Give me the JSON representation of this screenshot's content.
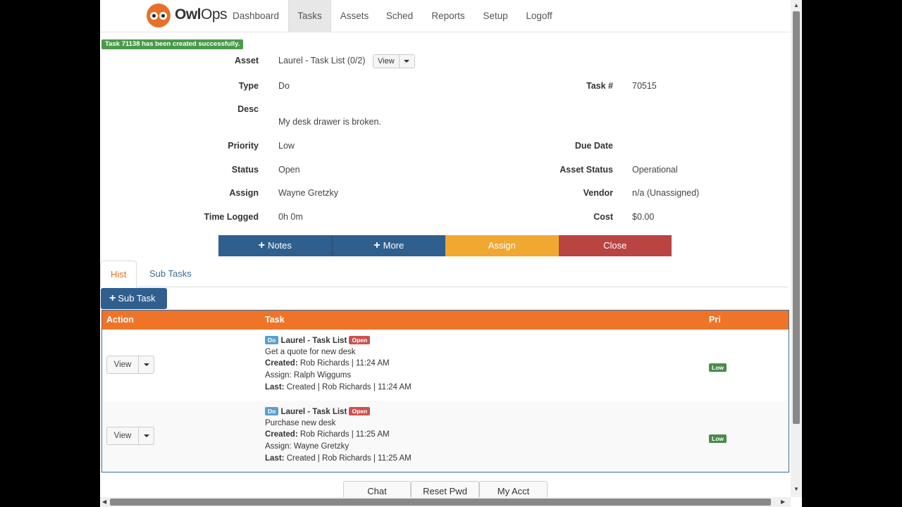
{
  "nav": {
    "brand_bold": "Owl",
    "brand_rest": "Ops",
    "items": [
      {
        "label": "Dashboard"
      },
      {
        "label": "Tasks"
      },
      {
        "label": "Assets"
      },
      {
        "label": "Sched"
      },
      {
        "label": "Reports"
      },
      {
        "label": "Setup"
      },
      {
        "label": "Logoff"
      }
    ]
  },
  "flash": "Task 71138 has been created successfully.",
  "details": {
    "asset_label": "Asset",
    "asset_value": "Laurel - Task List (0/2)",
    "view_label": "View",
    "type_label": "Type",
    "type_value": "Do",
    "task_no_label": "Task #",
    "task_no_value": "70515",
    "desc_label": "Desc",
    "desc_value": "My desk drawer is broken.",
    "priority_label": "Priority",
    "priority_value": "Low",
    "due_label": "Due Date",
    "due_value": "",
    "status_label": "Status",
    "status_value": "Open",
    "asset_status_label": "Asset Status",
    "asset_status_value": "Operational",
    "assign_label": "Assign",
    "assign_value": "Wayne Gretzky",
    "vendor_label": "Vendor",
    "vendor_value": "n/a (Unassigned)",
    "time_label": "Time Logged",
    "time_value": "0h 0m",
    "cost_label": "Cost",
    "cost_value": "$0.00"
  },
  "actions": {
    "notes": "Notes",
    "more": "More",
    "assign": "Assign",
    "close": "Close",
    "colors": {
      "notes": "#2f5f8f",
      "more": "#2f5f8f",
      "assign": "#f0a830",
      "close": "#b94441"
    }
  },
  "tabs": {
    "hist": "Hist",
    "sub_tasks": "Sub Tasks"
  },
  "sub_task_button": "Sub Task",
  "table": {
    "headers": {
      "action": "Action",
      "task": "Task",
      "pri": "Pri"
    },
    "rows": [
      {
        "view": "View",
        "type_badge": "Do",
        "asset": "Laurel - Task List",
        "status_badge": "Open",
        "desc": "Get a quote for new desk",
        "created_label": "Created:",
        "created": "Rob Richards | 11:24 AM",
        "assign": "Assign: Ralph Wiggums",
        "last_label": "Last:",
        "last": "Created | Rob Richards | 11:24 AM",
        "priority": "Low"
      },
      {
        "view": "View",
        "type_badge": "Do",
        "asset": "Laurel - Task List",
        "status_badge": "Open",
        "desc": "Purchase new desk",
        "created_label": "Created:",
        "created": "Rob Richards | 11:25 AM",
        "assign": "Assign: Wayne Gretzky",
        "last_label": "Last:",
        "last": "Created | Rob Richards | 11:25 AM",
        "priority": "Low"
      }
    ]
  },
  "footer": {
    "chat": "Chat",
    "reset_pwd": "Reset Pwd",
    "my_acct": "My Acct"
  }
}
